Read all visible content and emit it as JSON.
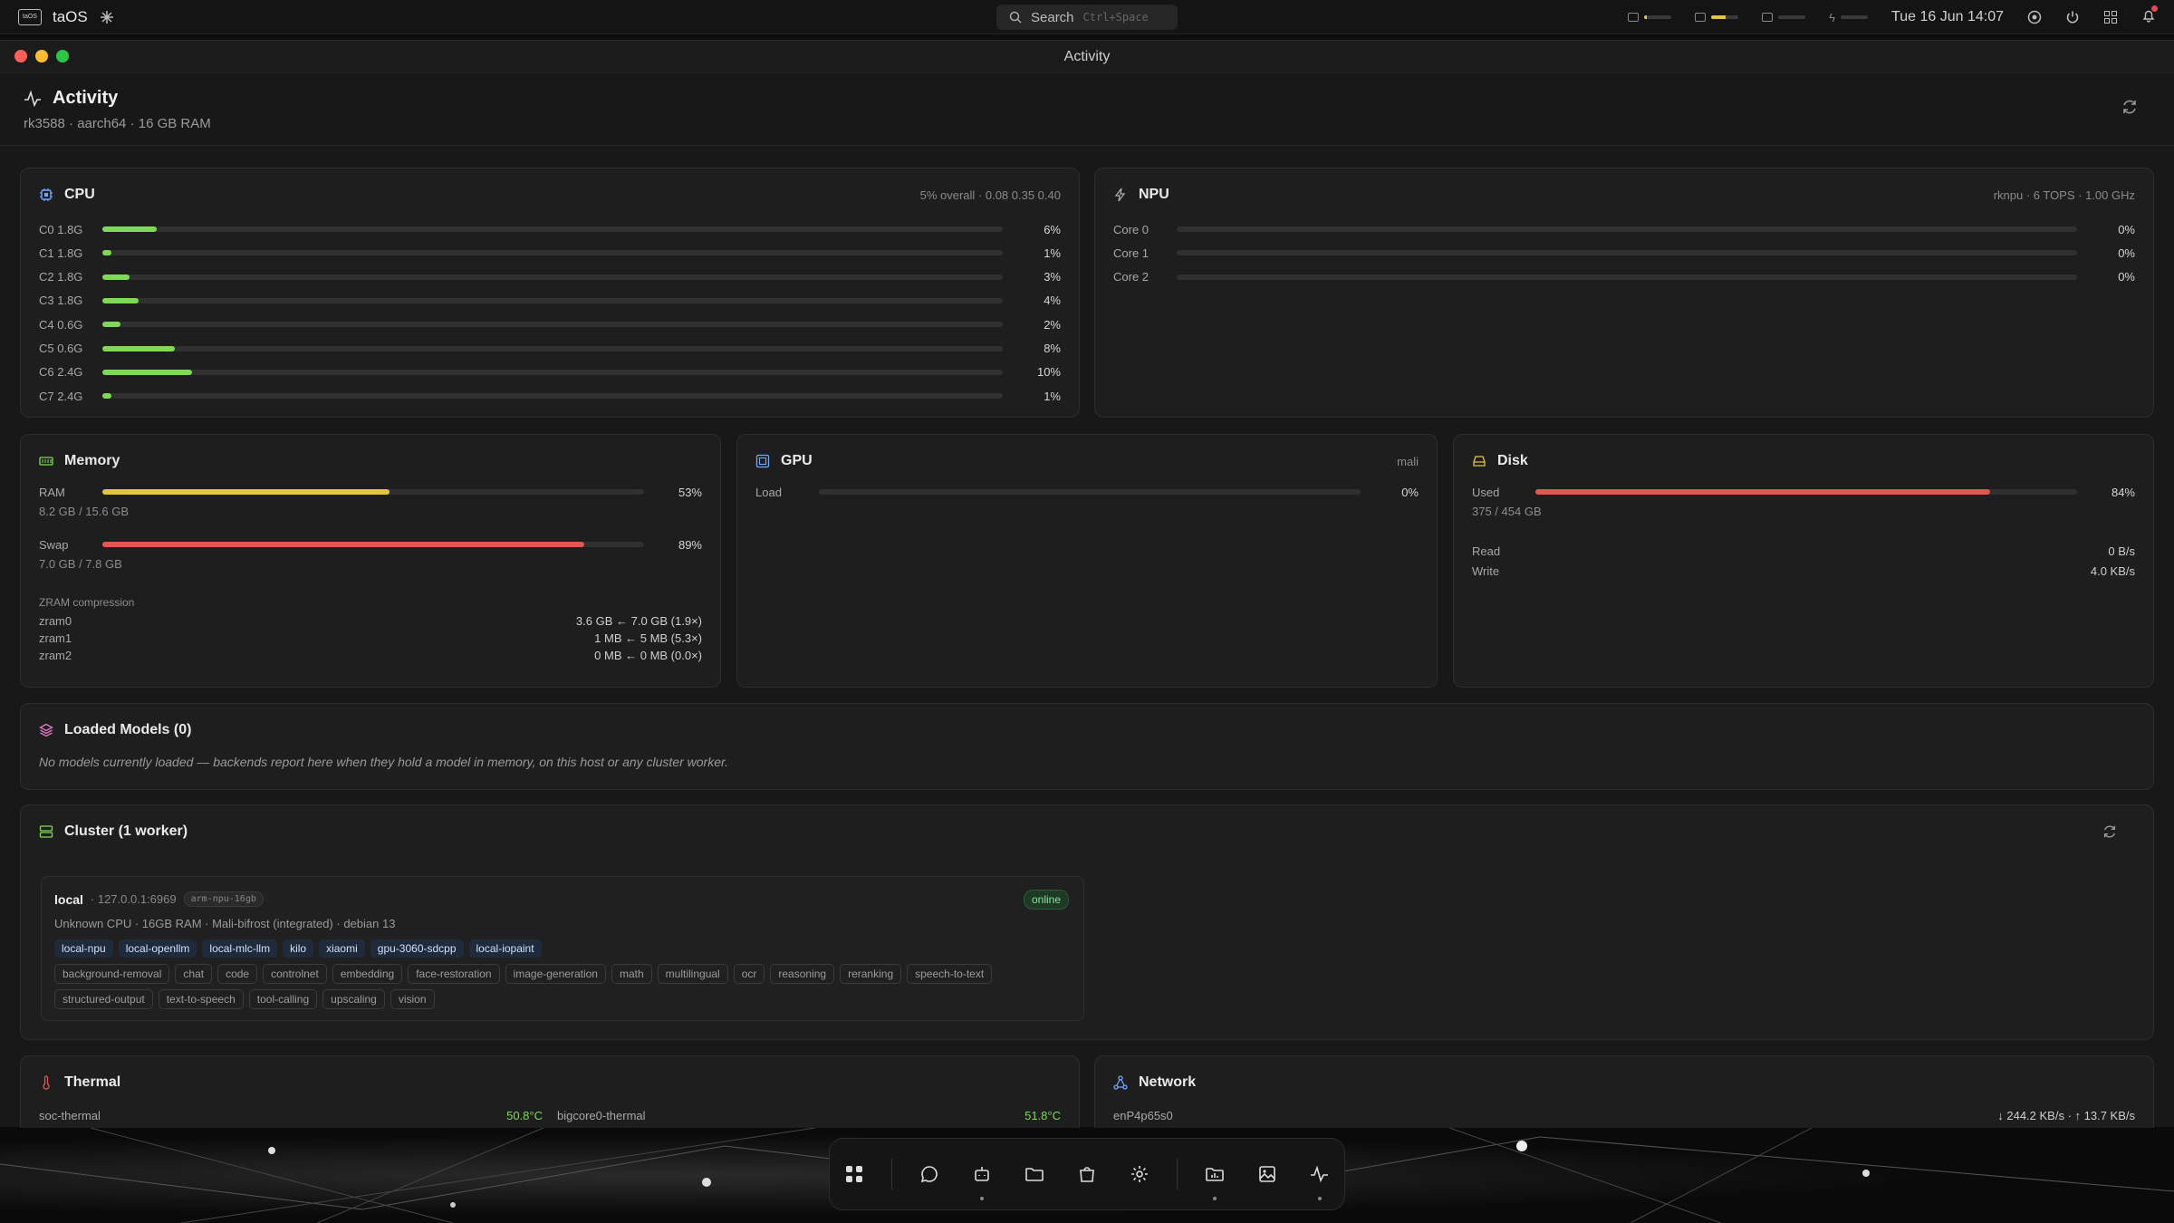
{
  "topbar": {
    "logo_text": "taOS",
    "app_name": "taOS",
    "search_label": "Search",
    "search_kbd": "Ctrl+Space",
    "datetime": "Tue 16 Jun 14:07"
  },
  "window": {
    "title": "Activity"
  },
  "header": {
    "title": "Activity",
    "subtitle": "rk3588 · aarch64 · 16 GB RAM"
  },
  "cpu": {
    "title": "CPU",
    "meta": "5% overall · 0.08 0.35 0.40",
    "cores": [
      {
        "label": "C0 1.8G",
        "pct": "6%",
        "value": 6
      },
      {
        "label": "C1 1.8G",
        "pct": "1%",
        "value": 1
      },
      {
        "label": "C2 1.8G",
        "pct": "3%",
        "value": 3
      },
      {
        "label": "C3 1.8G",
        "pct": "4%",
        "value": 4
      },
      {
        "label": "C4 0.6G",
        "pct": "2%",
        "value": 2
      },
      {
        "label": "C5 0.6G",
        "pct": "8%",
        "value": 8
      },
      {
        "label": "C6 2.4G",
        "pct": "10%",
        "value": 10
      },
      {
        "label": "C7 2.4G",
        "pct": "1%",
        "value": 1
      }
    ]
  },
  "npu": {
    "title": "NPU",
    "meta": "rknpu · 6 TOPS · 1.00 GHz",
    "cores": [
      {
        "label": "Core 0",
        "pct": "0%",
        "value": 0
      },
      {
        "label": "Core 1",
        "pct": "0%",
        "value": 0
      },
      {
        "label": "Core 2",
        "pct": "0%",
        "value": 0
      }
    ]
  },
  "memory": {
    "title": "Memory",
    "ram_label": "RAM",
    "ram_pct": "53%",
    "ram_value": 53,
    "ram_detail": "8.2 GB / 15.6 GB",
    "swap_label": "Swap",
    "swap_pct": "89%",
    "swap_value": 89,
    "swap_detail": "7.0 GB / 7.8 GB",
    "zram_title": "ZRAM compression",
    "zram": [
      {
        "name": "zram0",
        "value": "3.6 GB ← 7.0 GB (1.9×)"
      },
      {
        "name": "zram1",
        "value": "1 MB ← 5 MB (5.3×)"
      },
      {
        "name": "zram2",
        "value": "0 MB ← 0 MB (0.0×)"
      }
    ]
  },
  "gpu": {
    "title": "GPU",
    "meta": "mali",
    "load_label": "Load",
    "load_pct": "0%",
    "load_value": 0
  },
  "disk": {
    "title": "Disk",
    "used_label": "Used",
    "used_pct": "84%",
    "used_value": 84,
    "used_detail": "375 / 454 GB",
    "read_label": "Read",
    "read_value": "0 B/s",
    "write_label": "Write",
    "write_value": "4.0 KB/s"
  },
  "models": {
    "title": "Loaded Models (0)",
    "empty": "No models currently loaded — backends report here when they hold a model in memory, on this host or any cluster worker."
  },
  "cluster": {
    "title": "Cluster (1 worker)",
    "worker": {
      "name": "local",
      "address": "· 127.0.0.1:6969",
      "tag": "arm-npu-16gb",
      "status": "online",
      "specs": "Unknown CPU · 16GB RAM · Mali-bifrost (integrated) · debian 13",
      "backends": [
        "local-npu",
        "local-openllm",
        "local-mlc-llm",
        "kilo",
        "xiaomi",
        "gpu-3060-sdcpp",
        "local-iopaint"
      ],
      "capabilities_row1": [
        "background-removal",
        "chat",
        "code",
        "controlnet",
        "embedding",
        "face-restoration",
        "image-generation",
        "math",
        "multilingual",
        "ocr",
        "reasoning",
        "reranking",
        "speech-to-text"
      ],
      "capabilities_row2": [
        "structured-output",
        "text-to-speech",
        "tool-calling",
        "upscaling",
        "vision"
      ]
    }
  },
  "thermal": {
    "title": "Thermal",
    "s1_name": "soc-thermal",
    "s1_value": "50.8°C",
    "s2_name": "bigcore0-thermal",
    "s2_value": "51.8°C"
  },
  "network": {
    "title": "Network",
    "iface": "enP4p65s0",
    "rates": "↓ 244.2 KB/s · ↑ 13.7 KB/s"
  },
  "colors": {
    "cpu_bar": "#7ed957",
    "ram_bar": "#e4c53b",
    "swap_bar": "#e0584f",
    "disk_bar": "#e0584f",
    "accent_blue": "#6ea8ff"
  }
}
